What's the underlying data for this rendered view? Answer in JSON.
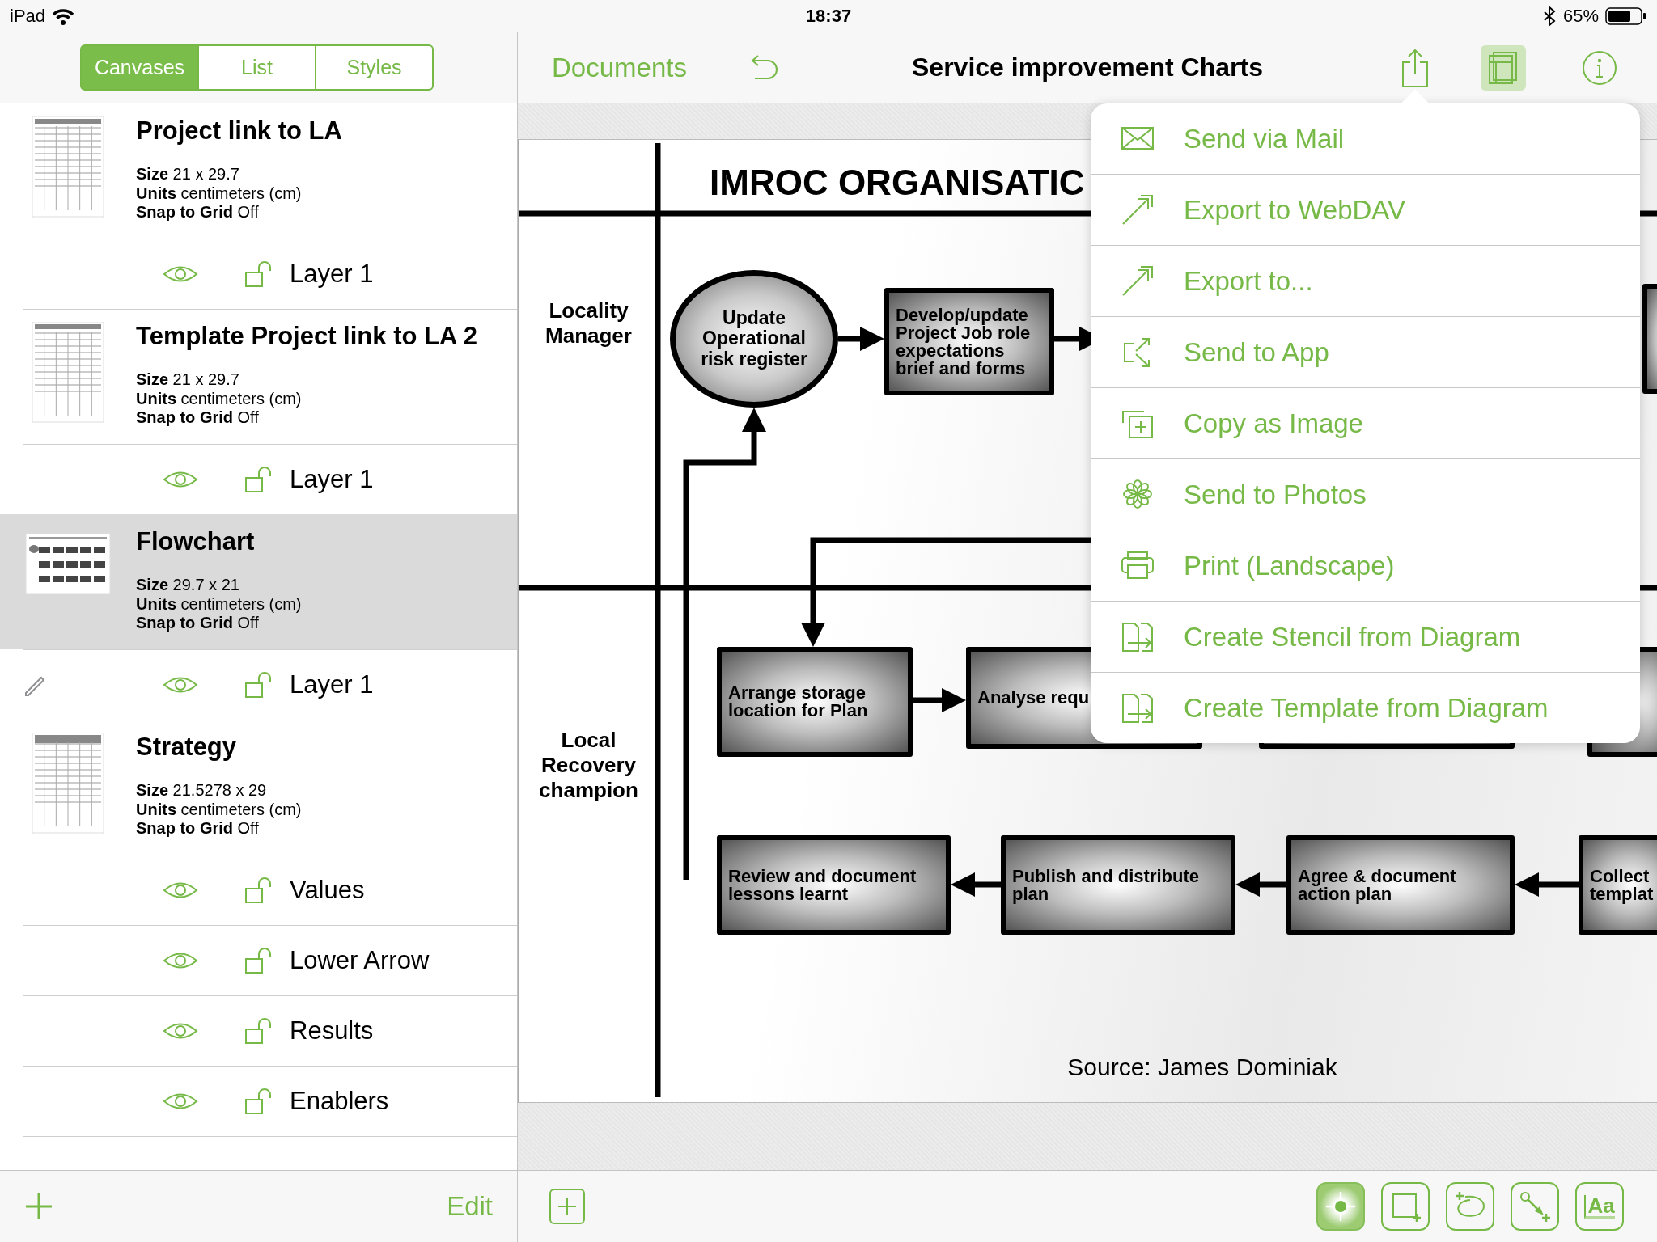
{
  "status_bar": {
    "device": "iPad",
    "time": "18:37",
    "battery": "65%"
  },
  "sidebar": {
    "segments": [
      {
        "label": "Canvases",
        "selected": true
      },
      {
        "label": "List",
        "selected": false
      },
      {
        "label": "Styles",
        "selected": false
      }
    ],
    "canvases": [
      {
        "name": "Project link to LA",
        "selected": false,
        "details": [
          "**Size** 21 x 29.7",
          "**Units** centimeters (cm)",
          "**Snap to Grid** Off"
        ],
        "layers": [
          {
            "name": "Layer 1",
            "editing": false
          }
        ]
      },
      {
        "name": "Template Project link to LA 2",
        "selected": false,
        "details": [
          "**Size** 21 x 29.7",
          "**Units** centimeters (cm)",
          "**Snap to Grid** Off"
        ],
        "layers": [
          {
            "name": "Layer 1",
            "editing": false
          }
        ]
      },
      {
        "name": "Flowchart",
        "selected": true,
        "details": [
          "**Size** 29.7 x 21",
          "**Units** centimeters (cm)",
          "**Snap to Grid** Off"
        ],
        "layers": [
          {
            "name": "Layer 1",
            "editing": true
          }
        ]
      },
      {
        "name": "Strategy",
        "selected": false,
        "details": [
          "**Size** 21.5278 x 29",
          "**Units** centimeters (cm)",
          "**Snap to Grid** Off"
        ],
        "layers": [
          {
            "name": "Values",
            "editing": false
          },
          {
            "name": "Lower Arrow",
            "editing": false
          },
          {
            "name": "Results",
            "editing": false
          },
          {
            "name": "Enablers",
            "editing": false
          }
        ]
      }
    ],
    "edit_button": "Edit"
  },
  "nav": {
    "back": "Documents",
    "title": "Service improvement Charts",
    "canvases_panel_on": true
  },
  "diagram": {
    "title": "IMROC ORGANISATIC",
    "lanes": [
      "Locality Manager",
      "Local Recovery champion"
    ],
    "nodes": [
      {
        "kind": "ellipse",
        "text": "Update\nOperational\nrisk register"
      },
      {
        "kind": "box",
        "text": "Develop/update\nProject Job role\nexpectations\nbrief and forms"
      },
      {
        "kind": "box"
      },
      {
        "kind": "box",
        "text": "Arrange storage\nlocation for Plan"
      },
      {
        "kind": "box",
        "text": "Analyse requ"
      },
      {
        "kind": "box"
      },
      {
        "kind": "box"
      },
      {
        "kind": "box",
        "text": "Review and document\nlessons learnt"
      },
      {
        "kind": "box",
        "text": "Publish and distribute\nplan"
      },
      {
        "kind": "box",
        "text": "Agree & document\naction plan"
      },
      {
        "kind": "box",
        "text": "Collect\ntemplat"
      }
    ],
    "source": "Source: James Dominiak"
  },
  "share_menu": [
    {
      "kind": "mail",
      "label": "Send via Mail"
    },
    {
      "kind": "webdav",
      "label": "Export to WebDAV"
    },
    {
      "kind": "export",
      "label": "Export to..."
    },
    {
      "kind": "app",
      "label": "Send to App"
    },
    {
      "kind": "copy",
      "label": "Copy as Image"
    },
    {
      "kind": "photos",
      "label": "Send to Photos"
    },
    {
      "kind": "print",
      "label": "Print (Landscape)"
    },
    {
      "kind": "stencil",
      "label": "Create Stencil from Diagram"
    },
    {
      "kind": "template",
      "label": "Create Template from Diagram"
    }
  ],
  "tools": [
    {
      "kind": "select",
      "selected": true
    },
    {
      "kind": "shape",
      "selected": false
    },
    {
      "kind": "freehand",
      "selected": false
    },
    {
      "kind": "line",
      "selected": false
    },
    {
      "kind": "text",
      "glyph": "Aa",
      "selected": false
    }
  ]
}
